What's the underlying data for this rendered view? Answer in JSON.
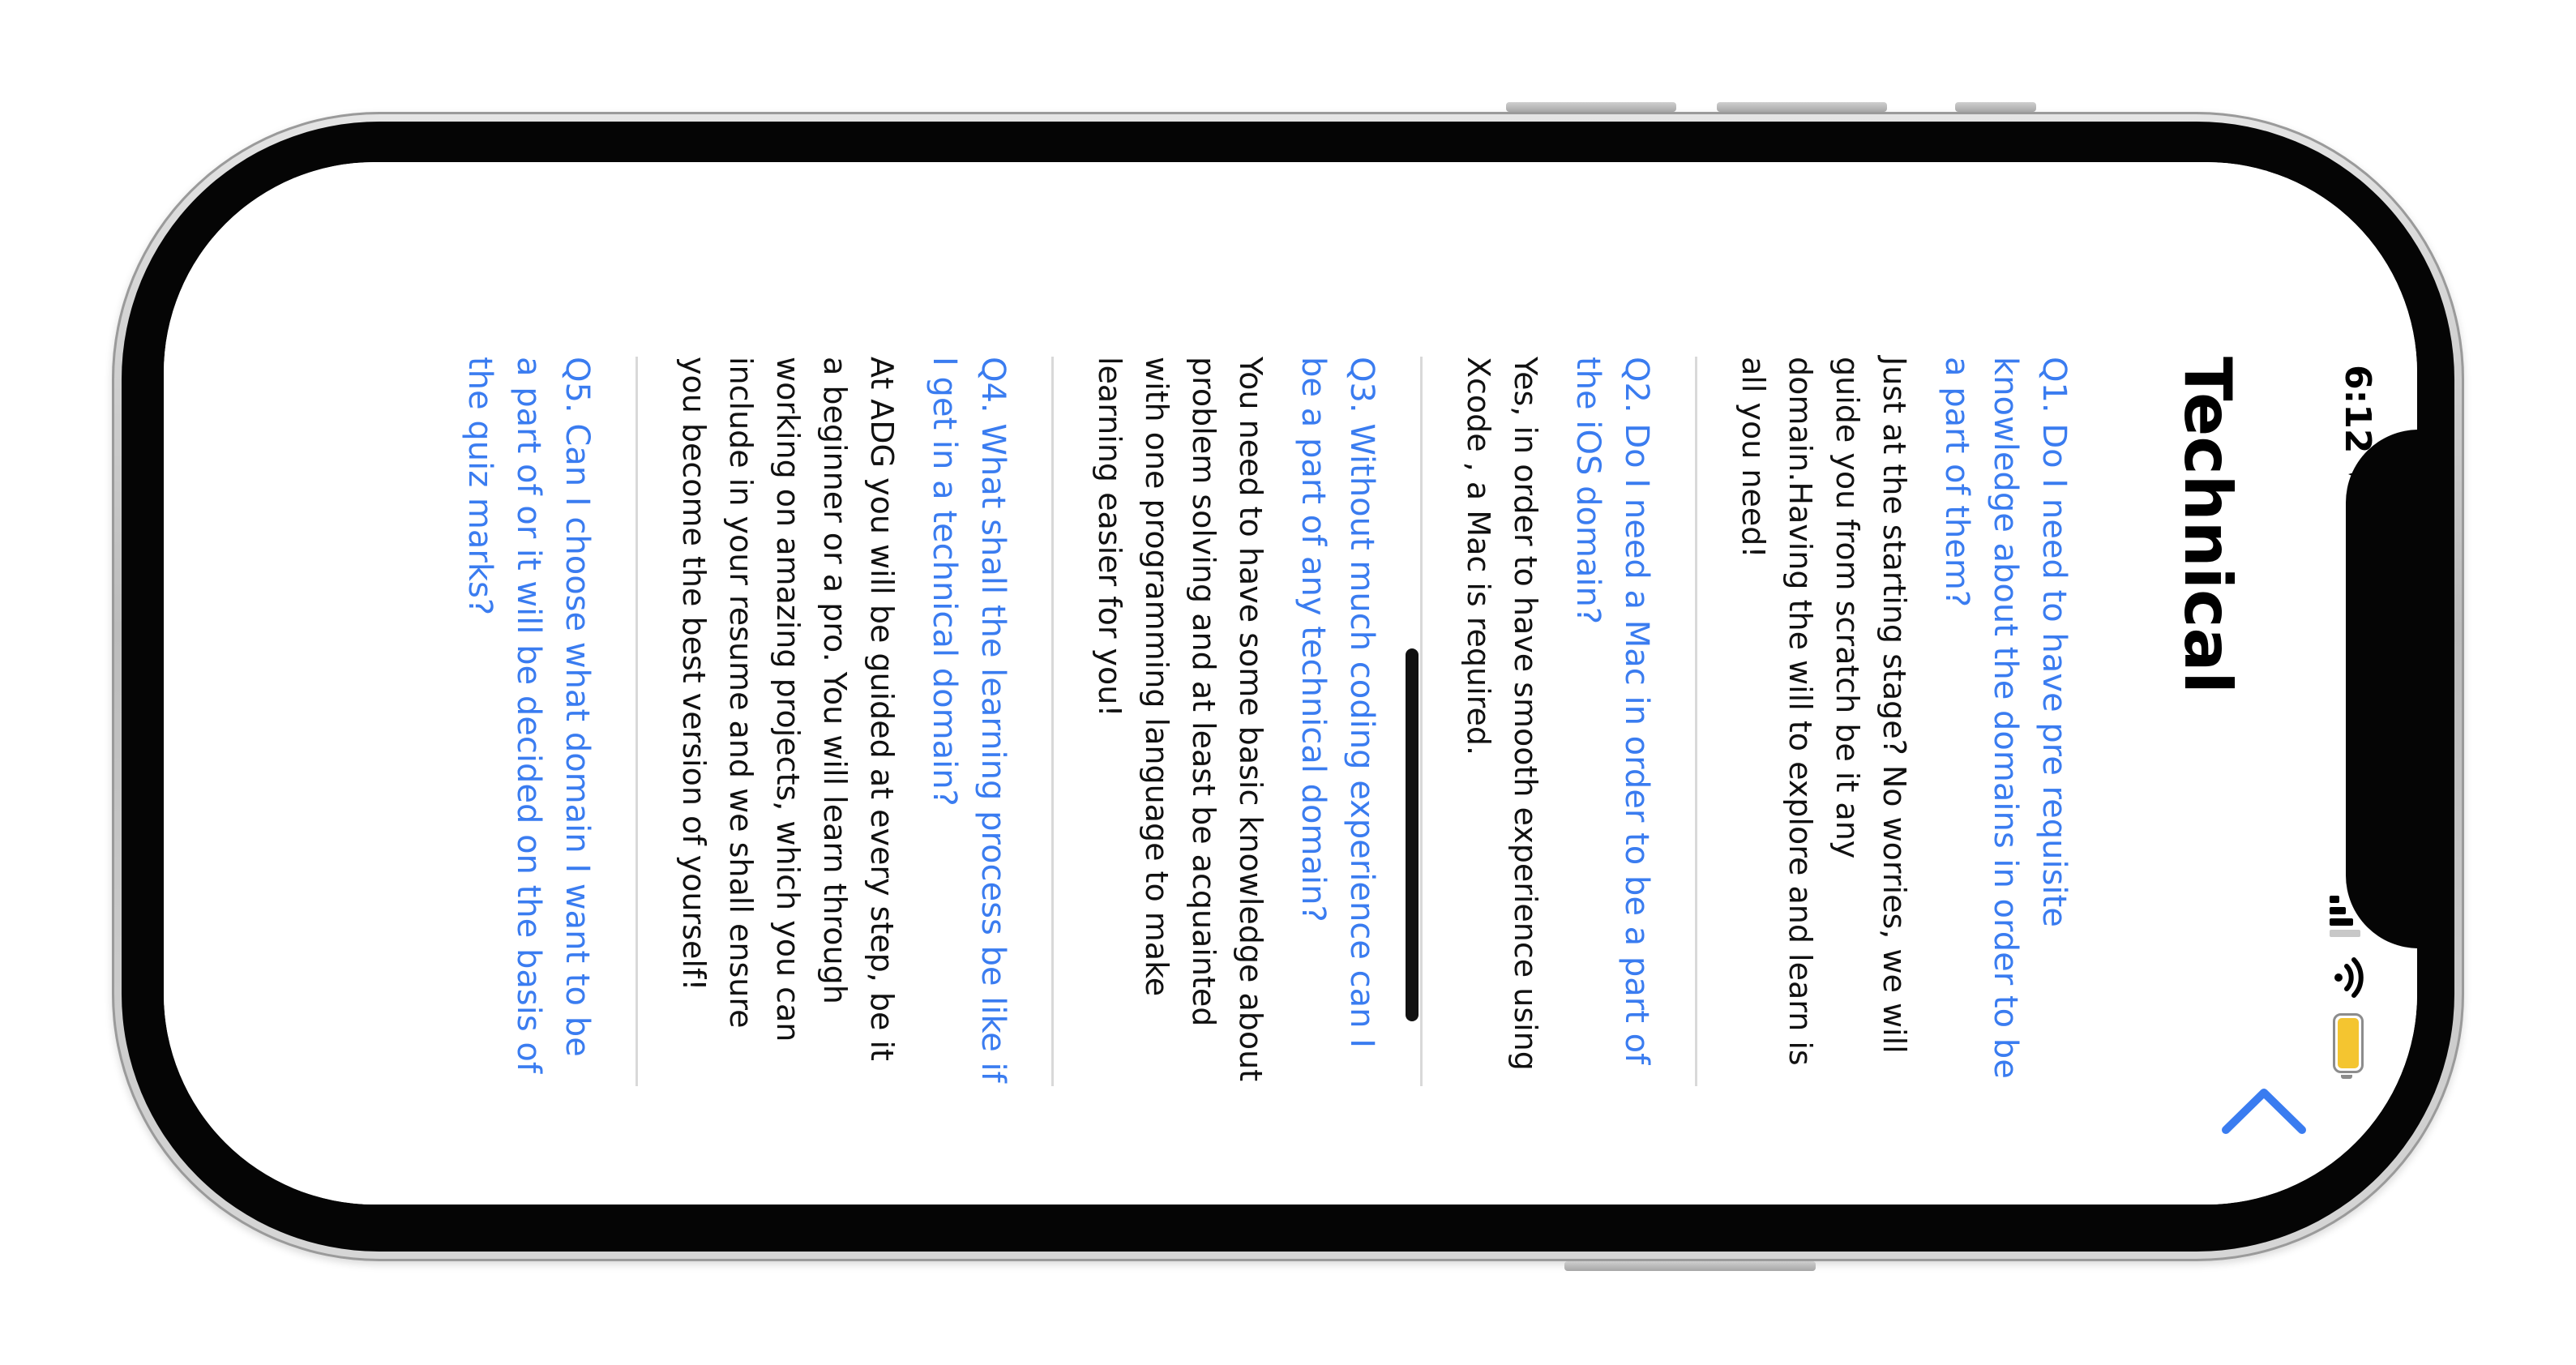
{
  "status_bar": {
    "time": "6:12",
    "location_icon": "location-arrow-icon",
    "signal_icon": "cellular-signal-icon",
    "wifi_icon": "wifi-icon",
    "battery_icon": "battery-icon",
    "battery_color": "#f4c530"
  },
  "nav": {
    "back_icon": "chevron-left-icon",
    "title": "Technical"
  },
  "accent_color": "#3a7cf0",
  "faq": [
    {
      "question": "Q1. Do I need to have pre requisite knowledge about the domains in order to be a part of them?",
      "answer": "Just at the starting stage? No worries, we will guide you from scratch be it any domain.Having the will to explore and learn is all you need!"
    },
    {
      "question": "Q2. Do I need a Mac in order to be a part of the iOS domain?",
      "answer": "Yes, in order to have smooth experience using Xcode , a Mac is required."
    },
    {
      "question": "Q3. Without much coding experience can I be a part of any technical domain?",
      "answer": "You need to have some basic knowledge about problem solving and at least be acquainted with one programming language to make learning easier for you!"
    },
    {
      "question": "Q4. What shall the learning process be like if I get in a technical domain?",
      "answer": "At ADG you will be guided at every step, be it a beginner or a pro. You will learn through working on amazing projects, which you can include in your resume and we shall ensure you become the best version of yourself!"
    },
    {
      "question": "Q5. Can I choose what domain I want to be a part of or it will be decided on the basis of the quiz marks?",
      "answer": ""
    }
  ]
}
